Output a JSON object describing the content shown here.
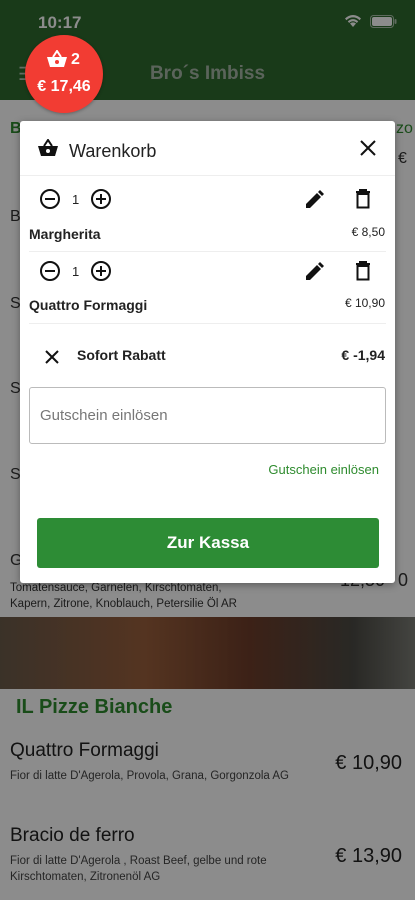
{
  "status_bar": {
    "time": "10:17"
  },
  "app_bar": {
    "title": "Bro´s Imbiss"
  },
  "cart_badge": {
    "count": "2",
    "total": "€ 17,46"
  },
  "background": {
    "peek_rows": [
      "B",
      "B",
      "S",
      "S",
      "S",
      "G"
    ],
    "peek_right": [
      "zo",
      "€",
      "0"
    ],
    "peek_desc": "Tomatensauce, Garnelen, Kirschtomaten, Kapern, Zitrone, Knoblauch, Petersilie Öl  AR",
    "peek_price": "12,50",
    "section_title": "IL Pizze Bianche",
    "items": [
      {
        "name": "Quattro Formaggi",
        "desc": "Fior di latte D'Agerola, Provola, Grana, Gorgonzola AG",
        "price": "€ 10,90"
      },
      {
        "name": "Bracio de ferro",
        "desc": "Fior di latte D'Agerola , Roast Beef, gelbe und rote Kirschtomaten, Zitronenöl AG",
        "price": "€ 13,90"
      }
    ]
  },
  "cart_dialog": {
    "title": "Warenkorb",
    "items": [
      {
        "qty": "1",
        "name": "Margherita",
        "price": "€ 8,50"
      },
      {
        "qty": "1",
        "name": "Quattro Formaggi",
        "price": "€ 10,90"
      }
    ],
    "discount": {
      "label": "Sofort Rabatt",
      "value": "€ -1,94"
    },
    "voucher": {
      "placeholder": "Gutschein einlösen",
      "value": "",
      "link_label": "Gutschein einlösen"
    },
    "checkout_label": "Zur Kassa"
  },
  "colors": {
    "brand_green": "#2e6a2e",
    "button_green": "#2d8c35",
    "badge_red": "#f23c33"
  }
}
